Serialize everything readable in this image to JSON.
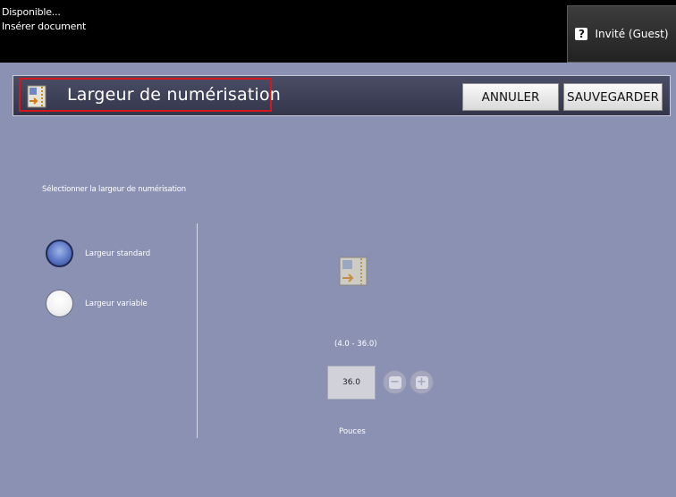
{
  "status": {
    "line1": "Disponible...",
    "line2": "Insérer document"
  },
  "user": {
    "label": "Invité (Guest)",
    "icon": "question-lock-icon"
  },
  "header": {
    "title": "Largeur de numérisation",
    "icon": "scan-document-icon",
    "cancel_label": "ANNULER",
    "save_label": "SAUVEGARDER"
  },
  "main": {
    "section_label": "Sélectionner la largeur de numérisation",
    "options": [
      {
        "label": "Largeur standard",
        "selected": true
      },
      {
        "label": "Largeur variable",
        "selected": false
      }
    ],
    "range": "(4.0 - 36.0)",
    "value": "36.0",
    "unit": "Pouces",
    "minus_icon": "minus-icon",
    "plus_icon": "plus-icon"
  },
  "colors": {
    "background": "#8b91b2",
    "header": "#3d4157",
    "highlight": "#d5171b",
    "radio_selected": "#5a76c4"
  }
}
